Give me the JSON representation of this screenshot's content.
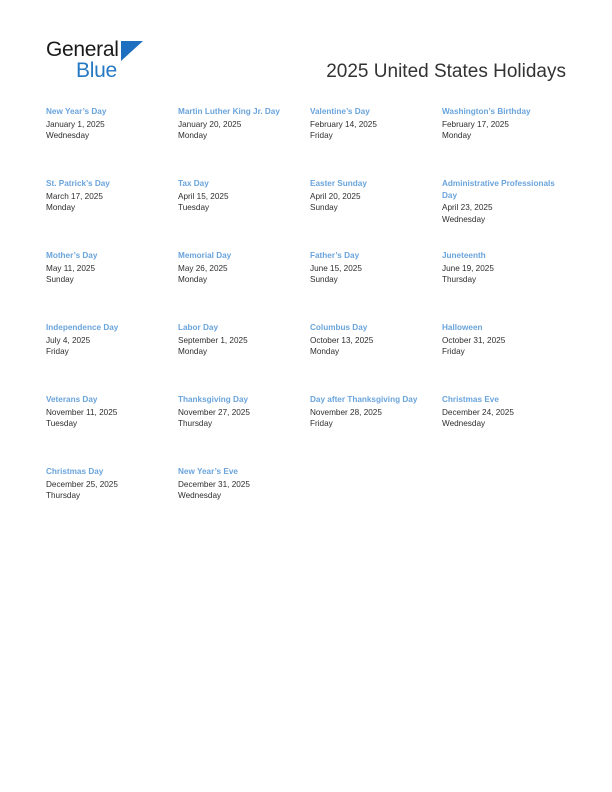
{
  "document": {
    "title": "2025 United States Holidays",
    "accent_color": "#6aa4dc",
    "text_color": "#2e2e2e",
    "background_color": "#ffffff"
  },
  "logo": {
    "word_primary": "General",
    "word_secondary": "Blue",
    "primary_color": "#1a1a1a",
    "secondary_color": "#2579c4",
    "mark_color": "#1f6fc0"
  },
  "holidays": [
    [
      {
        "name": "New Year’s Day",
        "date": "January 1, 2025",
        "weekday": "Wednesday"
      },
      {
        "name": "Martin Luther King Jr. Day",
        "date": "January 20, 2025",
        "weekday": "Monday"
      },
      {
        "name": "Valentine’s Day",
        "date": "February 14, 2025",
        "weekday": "Friday"
      },
      {
        "name": "Washington’s Birthday",
        "date": "February 17, 2025",
        "weekday": "Monday"
      }
    ],
    [
      {
        "name": "St. Patrick’s Day",
        "date": "March 17, 2025",
        "weekday": "Monday"
      },
      {
        "name": "Tax Day",
        "date": "April 15, 2025",
        "weekday": "Tuesday"
      },
      {
        "name": "Easter Sunday",
        "date": "April 20, 2025",
        "weekday": "Sunday"
      },
      {
        "name": "Administrative Professionals Day",
        "date": "April 23, 2025",
        "weekday": "Wednesday"
      }
    ],
    [
      {
        "name": "Mother’s Day",
        "date": "May 11, 2025",
        "weekday": "Sunday"
      },
      {
        "name": "Memorial Day",
        "date": "May 26, 2025",
        "weekday": "Monday"
      },
      {
        "name": "Father’s Day",
        "date": "June 15, 2025",
        "weekday": "Sunday"
      },
      {
        "name": "Juneteenth",
        "date": "June 19, 2025",
        "weekday": "Thursday"
      }
    ],
    [
      {
        "name": "Independence Day",
        "date": "July 4, 2025",
        "weekday": "Friday"
      },
      {
        "name": "Labor Day",
        "date": "September 1, 2025",
        "weekday": "Monday"
      },
      {
        "name": "Columbus Day",
        "date": "October 13, 2025",
        "weekday": "Monday"
      },
      {
        "name": "Halloween",
        "date": "October 31, 2025",
        "weekday": "Friday"
      }
    ],
    [
      {
        "name": "Veterans Day",
        "date": "November 11, 2025",
        "weekday": "Tuesday"
      },
      {
        "name": "Thanksgiving Day",
        "date": "November 27, 2025",
        "weekday": "Thursday"
      },
      {
        "name": "Day after Thanksgiving Day",
        "date": "November 28, 2025",
        "weekday": "Friday"
      },
      {
        "name": "Christmas Eve",
        "date": "December 24, 2025",
        "weekday": "Wednesday"
      }
    ],
    [
      {
        "name": "Christmas Day",
        "date": "December 25, 2025",
        "weekday": "Thursday"
      },
      {
        "name": "New Year’s Eve",
        "date": "December 31, 2025",
        "weekday": "Wednesday"
      },
      {
        "name": "",
        "date": "",
        "weekday": ""
      },
      {
        "name": "",
        "date": "",
        "weekday": ""
      }
    ]
  ]
}
